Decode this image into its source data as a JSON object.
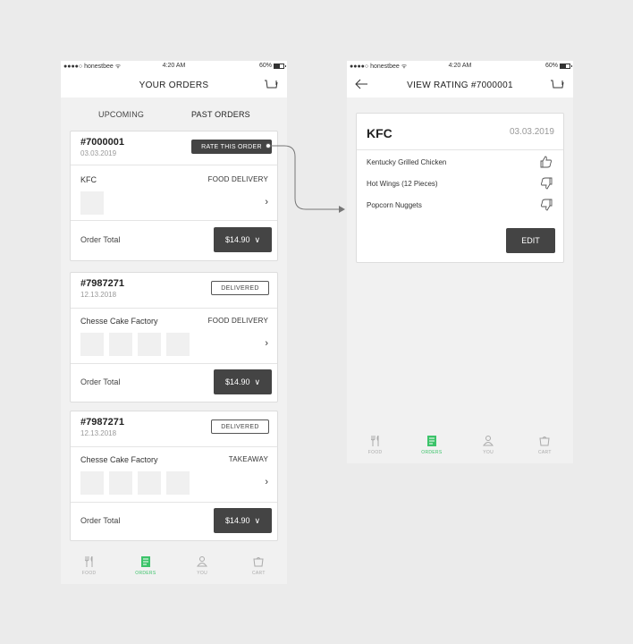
{
  "status_bar": {
    "carrier": "●●●●○ honestbee ᯤ",
    "time": "4:20 AM",
    "battery": "60%"
  },
  "orders_screen": {
    "title": "YOUR ORDERS",
    "tabs": {
      "upcoming": "UPCOMING",
      "past": "PAST ORDERS"
    },
    "total_label": "Order Total",
    "orders": [
      {
        "number": "#7000001",
        "date": "03.03.2019",
        "action": "RATE THIS ORDER",
        "restaurant": "KFC",
        "type": "FOOD DELIVERY",
        "price": "$14.90",
        "thumb_count": 1
      },
      {
        "number": "#7987271",
        "date": "12.13.2018",
        "status": "DELIVERED",
        "restaurant": "Chesse Cake Factory",
        "type": "FOOD DELIVERY",
        "price": "$14.90",
        "thumb_count": 4
      },
      {
        "number": "#7987271",
        "date": "12.13.2018",
        "status": "DELIVERED",
        "restaurant": "Chesse Cake Factory",
        "type": "TAKEAWAY",
        "price": "$14.90",
        "thumb_count": 4
      }
    ]
  },
  "rating_screen": {
    "title": "VIEW RATING #7000001",
    "restaurant": "KFC",
    "date": "03.03.2019",
    "items": [
      {
        "name": "Kentucky Grilled Chicken",
        "rating": "thumbs-up"
      },
      {
        "name": "Hot Wings (12 Pieces)",
        "rating": "thumbs-down"
      },
      {
        "name": "Popcorn Nuggets",
        "rating": "thumbs-down"
      }
    ],
    "edit_label": "EDIT"
  },
  "tabbar": {
    "items": [
      {
        "label": "FOOD",
        "icon": "fork-knife-icon"
      },
      {
        "label": "ORDERS",
        "icon": "receipt-icon"
      },
      {
        "label": "YOU",
        "icon": "user-icon"
      },
      {
        "label": "CART",
        "icon": "cart-icon"
      }
    ],
    "active_color": "#3cc36a"
  },
  "colors": {
    "dark_button": "#444444",
    "accent": "#3cc36a"
  }
}
